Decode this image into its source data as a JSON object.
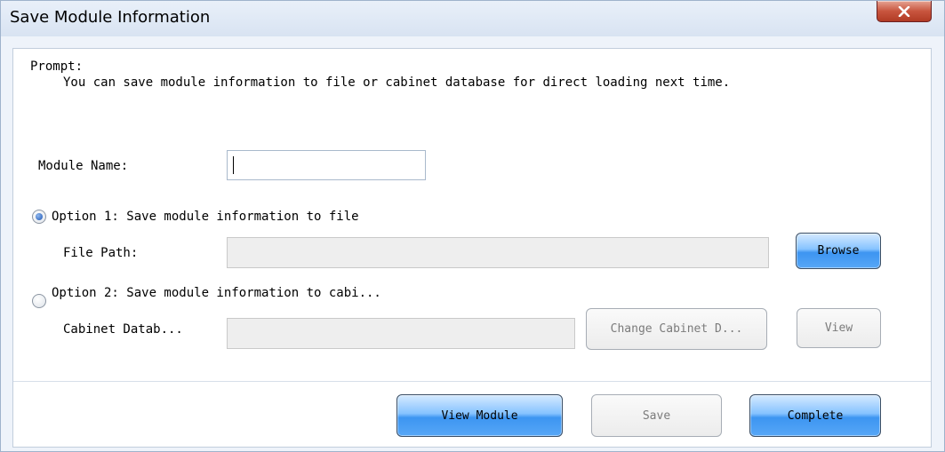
{
  "window": {
    "title": "Save Module Information"
  },
  "prompt": {
    "heading": "Prompt:",
    "message": "You can save module information to file or cabinet database for direct loading next time."
  },
  "module_name": {
    "label": "Module Name:",
    "value": ""
  },
  "option1": {
    "label": "Option 1: Save module information to file",
    "selected": true,
    "file_path_label": "File Path:",
    "file_path_value": "",
    "browse_label": "Browse"
  },
  "option2": {
    "label": "Option 2: Save module information to cabi...",
    "selected": false,
    "cabinet_db_label": "Cabinet Datab...",
    "cabinet_db_value": "",
    "change_label": "Change Cabinet D...",
    "view_label": "View"
  },
  "footer": {
    "view_module_label": "View Module",
    "save_label": "Save",
    "complete_label": "Complete"
  },
  "colors": {
    "accent_button": "#57a7f7",
    "close_button": "#c8553e"
  },
  "icons": {
    "close": "close-icon"
  }
}
